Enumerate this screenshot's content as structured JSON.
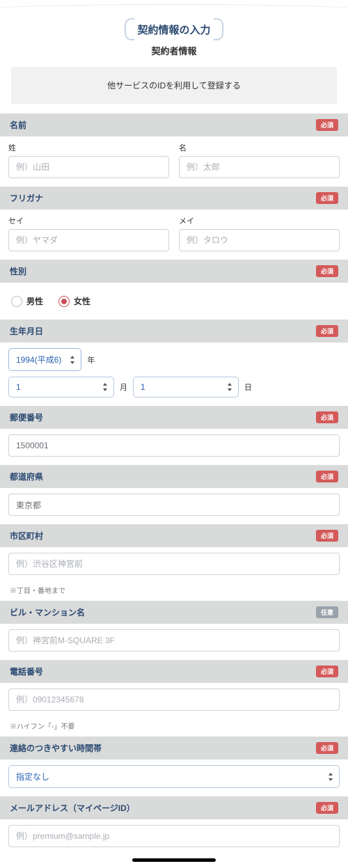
{
  "page": {
    "title": "契約情報の入力",
    "subtitle": "契約者情報"
  },
  "register_bar": "他サービスのIDを利用して登録する",
  "badges": {
    "required": "必須",
    "optional": "任意"
  },
  "name": {
    "header": "名前",
    "last_label": "姓",
    "first_label": "名",
    "last_placeholder": "例）山田",
    "first_placeholder": "例）太郎"
  },
  "furigana": {
    "header": "フリガナ",
    "last_label": "セイ",
    "first_label": "メイ",
    "last_placeholder": "例）ヤマダ",
    "first_placeholder": "例）タロウ"
  },
  "gender": {
    "header": "性別",
    "male": "男性",
    "female": "女性",
    "selected": "女性"
  },
  "birthdate": {
    "header": "生年月日",
    "year": "1994(平成6)",
    "year_unit": "年",
    "month": "1",
    "month_unit": "月",
    "day": "1",
    "day_unit": "日"
  },
  "postal": {
    "header": "郵便番号",
    "value": "1500001"
  },
  "prefecture": {
    "header": "都道府県",
    "value": "東京都"
  },
  "city": {
    "header": "市区町村",
    "placeholder": "例）渋谷区神宮前",
    "hint": "※丁目・番地まで"
  },
  "building": {
    "header": "ビル・マンション名",
    "placeholder": "例）神宮前M-SQUARE 3F"
  },
  "phone": {
    "header": "電話番号",
    "placeholder": "例）09012345678",
    "hint": "※ハイフン「-」不要"
  },
  "contact_time": {
    "header": "連絡のつきやすい時間帯",
    "value": "指定なし"
  },
  "email": {
    "header": "メールアドレス（マイページID）",
    "placeholder": "例）premium@sample.jp"
  }
}
